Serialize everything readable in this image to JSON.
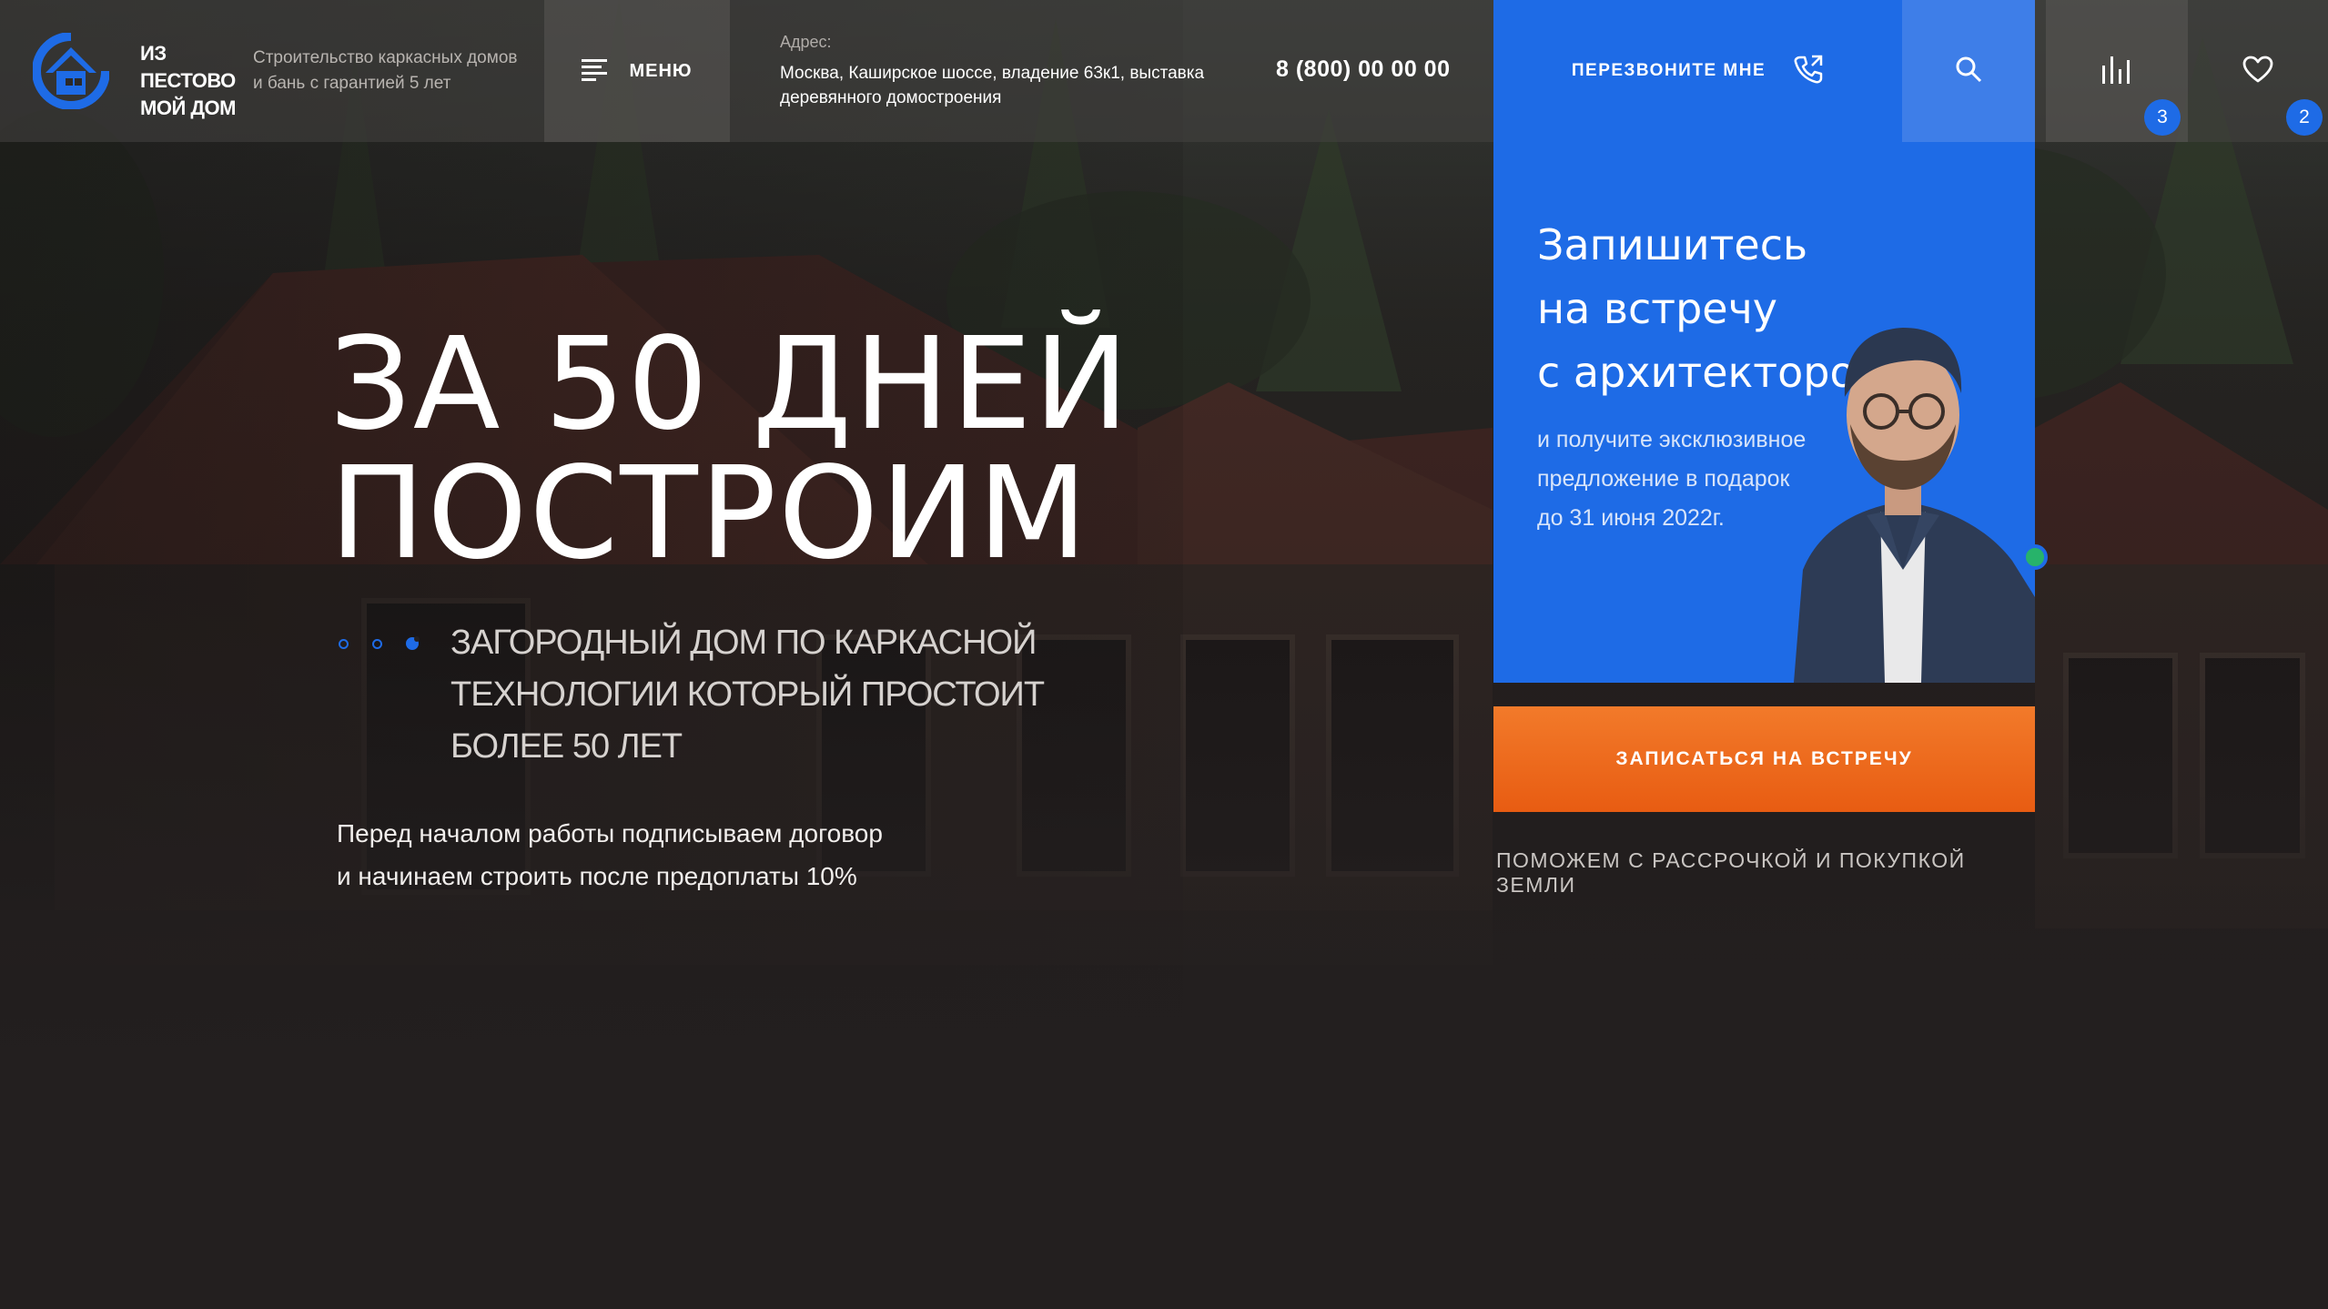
{
  "header": {
    "brand_line1": "ИЗ ПЕСТОВО",
    "brand_line2": "МОЙ ДОМ",
    "tagline": "Строительство каркасных домов и бань с гарантией 5 лет",
    "menu_label": "МЕНЮ",
    "address_caption": "Адрес:",
    "address_value": "Москва, Каширское шоссе, владение 63к1, выставка деревянного домостроения",
    "phone": "8 (800) 00 00 00",
    "callback_label": "ПЕРЕЗВОНИТЕ МНЕ",
    "compare_count": "3",
    "favorites_count": "2",
    "icons": [
      "logo-icon",
      "menu-icon",
      "phone-icon",
      "search-icon",
      "compare-icon",
      "heart-icon"
    ]
  },
  "hero": {
    "title_line1": "ЗА 50 ДНЕЙ",
    "title_line2": "ПОСТРОИМ",
    "subtitle": "ЗАГОРОДНЫЙ ДОМ ПО КАРКАСНОЙ ТЕХНОЛОГИИ КОТОРЫЙ ПРОСТОИТ БОЛЕЕ 50 ЛЕТ",
    "note_line1": "Перед началом работы подписываем договор",
    "note_line2": "и начинаем строить после предоплаты 10%",
    "slides_total": 3,
    "slide_active": 3
  },
  "promo": {
    "title_line1": "Запишитесь",
    "title_line2": "на встречу",
    "title_line3": "с архитектором",
    "text_line1": "и получите эксклюзивное",
    "text_line2": "предложение в подарок",
    "text_line3": "до 31 июня 2022г.",
    "cta_label": "ЗАПИСАТЬСЯ НА ВСТРЕЧУ",
    "help_text": "ПОМОЖЕМ С РАССРОЧКОЙ И ПОКУПКОЙ ЗЕМЛИ"
  },
  "colors": {
    "accent_blue": "#1e6be6",
    "cta_orange": "#ee6a1e",
    "online_green": "#27b36a",
    "background": "#231f1f"
  }
}
